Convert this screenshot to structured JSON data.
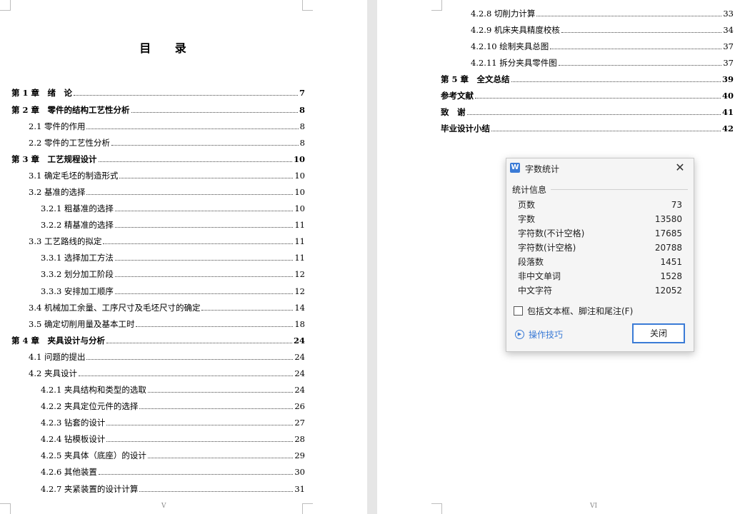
{
  "toc": {
    "title": "目 录",
    "left_entries": [
      {
        "label": "第 1 章　绪　论",
        "page": "7",
        "bold": true
      },
      {
        "label": "第 2 章　零件的结构工艺性分析",
        "page": "8",
        "bold": true
      },
      {
        "label": "2.1 零件的作用",
        "page": "8",
        "bold": false
      },
      {
        "label": "2.2 零件的工艺性分析",
        "page": "8",
        "bold": false
      },
      {
        "label": "第 3 章　工艺规程设计",
        "page": "10",
        "bold": true
      },
      {
        "label": "3.1 确定毛坯的制造形式",
        "page": "10",
        "bold": false
      },
      {
        "label": "3.2 基准的选择",
        "page": "10",
        "bold": false
      },
      {
        "label": "3.2.1 粗基准的选择",
        "page": "10",
        "bold": false
      },
      {
        "label": "3.2.2 精基准的选择",
        "page": "11",
        "bold": false
      },
      {
        "label": "3.3 工艺路线的拟定",
        "page": "11",
        "bold": false
      },
      {
        "label": "3.3.1  选择加工方法",
        "page": "11",
        "bold": false
      },
      {
        "label": "3.3.2  划分加工阶段",
        "page": "12",
        "bold": false
      },
      {
        "label": "3.3.3  安排加工顺序",
        "page": "12",
        "bold": false
      },
      {
        "label": "3.4 机械加工余量、工序尺寸及毛坯尺寸的确定",
        "page": "14",
        "bold": false
      },
      {
        "label": "3.5  确定切削用量及基本工时",
        "page": "18",
        "bold": false
      },
      {
        "label": "第 4 章　夹具设计与分析",
        "page": "24",
        "bold": true
      },
      {
        "label": "4.1 问题的提出",
        "page": "24",
        "bold": false
      },
      {
        "label": "4.2 夹具设计",
        "page": "24",
        "bold": false
      },
      {
        "label": "4.2.1  夹具结构和类型的选取",
        "page": "24",
        "bold": false
      },
      {
        "label": "4.2.2  夹具定位元件的选择",
        "page": "26",
        "bold": false
      },
      {
        "label": "4.2.3  钻套的设计",
        "page": "27",
        "bold": false
      },
      {
        "label": "4.2.4  钻模板设计",
        "page": "28",
        "bold": false
      },
      {
        "label": "4.2.5  夹具体（底座）的设计",
        "page": "29",
        "bold": false
      },
      {
        "label": "4.2.6  其他装置",
        "page": "30",
        "bold": false
      },
      {
        "label": "4.2.7  夹紧装置的设计计算",
        "page": "31",
        "bold": false
      }
    ],
    "right_entries": [
      {
        "label": "4.2.8  切削力计算",
        "page": "33",
        "bold": false
      },
      {
        "label": "4.2.9  机床夹具精度校核",
        "page": "34",
        "bold": false
      },
      {
        "label": "4.2.10  绘制夹具总图",
        "page": "37",
        "bold": false
      },
      {
        "label": "4.2.11  拆分夹具零件图",
        "page": "37",
        "bold": false
      },
      {
        "label": "第 5 章　全文总结",
        "page": "39",
        "bold": true
      },
      {
        "label": "参考文献",
        "page": "40",
        "bold": true
      },
      {
        "label": "致　谢",
        "page": "41",
        "bold": true
      },
      {
        "label": "毕业设计小结",
        "page": "42",
        "bold": true
      }
    ],
    "footer_left": "V",
    "footer_right": "VI"
  },
  "dialog": {
    "title": "字数统计",
    "app_icon": "W",
    "section_label": "统计信息",
    "stats": [
      {
        "label": "页数",
        "value": "73"
      },
      {
        "label": "字数",
        "value": "13580"
      },
      {
        "label": "字符数(不计空格)",
        "value": "17685"
      },
      {
        "label": "字符数(计空格)",
        "value": "20788"
      },
      {
        "label": "段落数",
        "value": "1451"
      },
      {
        "label": "非中文单词",
        "value": "1528"
      },
      {
        "label": "中文字符",
        "value": "12052"
      }
    ],
    "checkbox_label": "包括文本框、脚注和尾注(F)",
    "checkbox_checked": false,
    "tips_label": "操作技巧",
    "close_button": "关闭",
    "accent_color": "#3b7bd6"
  }
}
